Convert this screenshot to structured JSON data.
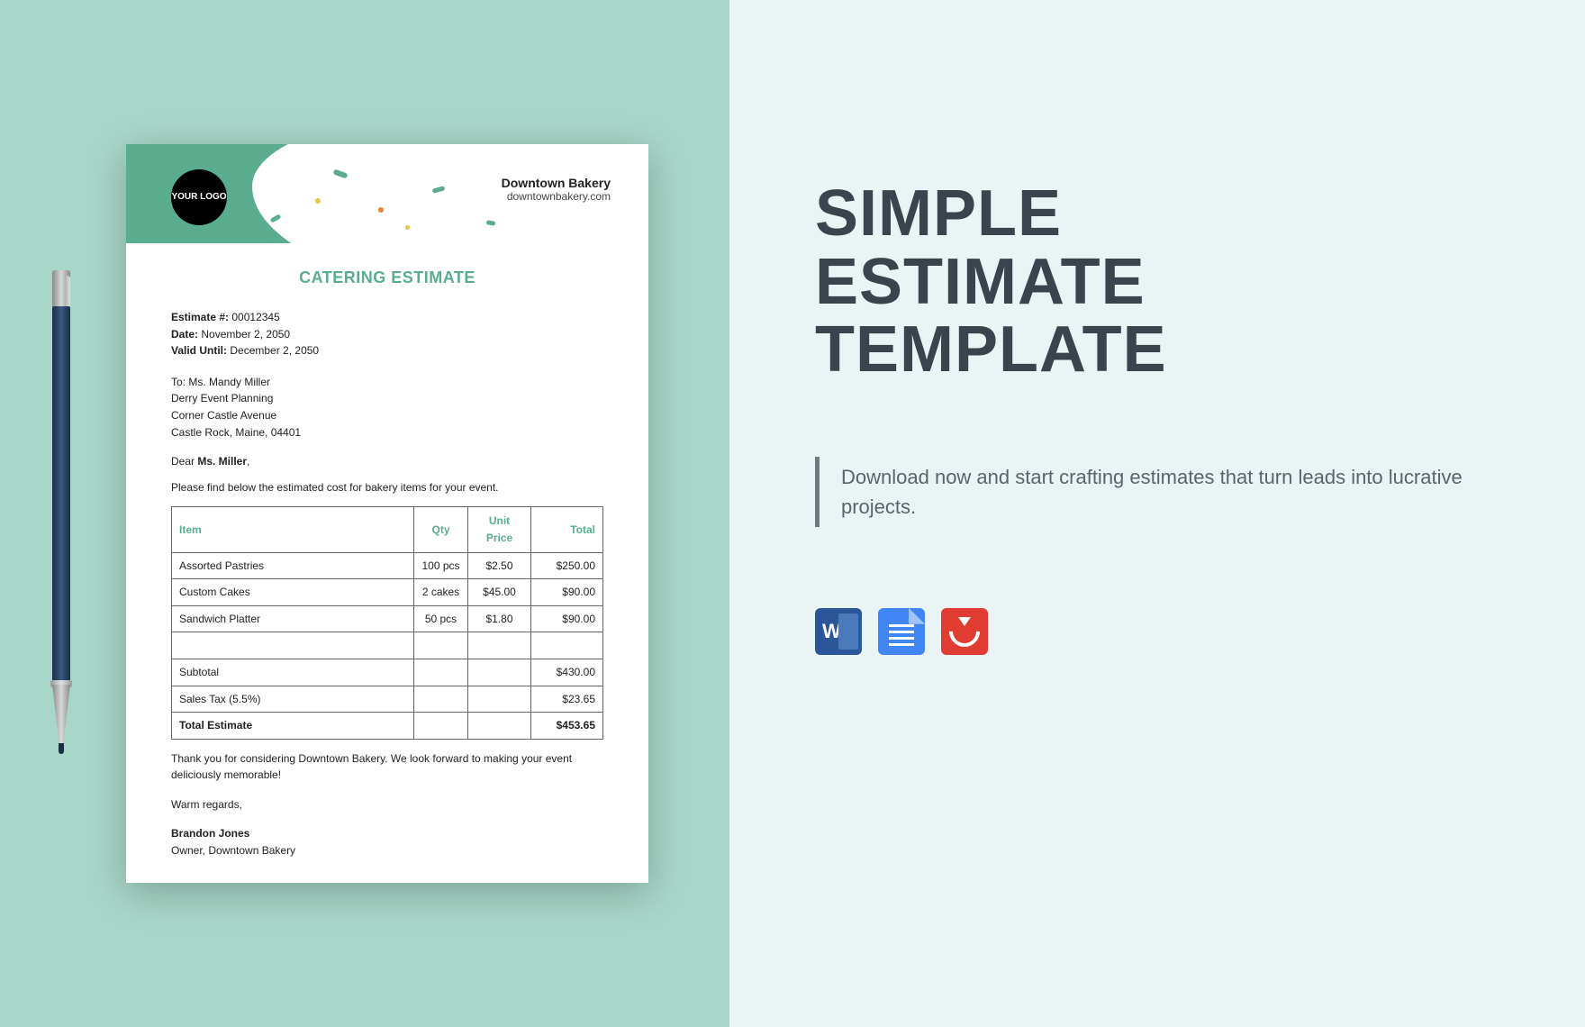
{
  "document": {
    "logo_text": "YOUR LOGO",
    "company_name": "Downtown Bakery",
    "company_url": "downtownbakery.com",
    "title": "CATERING ESTIMATE",
    "meta": {
      "estimate_label": "Estimate #:",
      "estimate_value": "00012345",
      "date_label": "Date:",
      "date_value": "November 2, 2050",
      "valid_label": "Valid Until:",
      "valid_value": "December 2, 2050"
    },
    "to": {
      "line1": "To: Ms. Mandy Miller",
      "line2": "Derry Event Planning",
      "line3": "Corner Castle Avenue",
      "line4": "Castle Rock, Maine, 04401"
    },
    "salutation_prefix": "Dear ",
    "salutation_name": "Ms. Miller",
    "salutation_suffix": ",",
    "intro": "Please find below the estimated cost for bakery items for your event.",
    "table": {
      "headers": {
        "item": "Item",
        "qty": "Qty",
        "unit": "Unit Price",
        "total": "Total"
      },
      "rows": [
        {
          "item": "Assorted Pastries",
          "qty": "100 pcs",
          "unit": "$2.50",
          "total": "$250.00"
        },
        {
          "item": "Custom Cakes",
          "qty": "2 cakes",
          "unit": "$45.00",
          "total": "$90.00"
        },
        {
          "item": "Sandwich Platter",
          "qty": "50 pcs",
          "unit": "$1.80",
          "total": "$90.00"
        }
      ],
      "subtotal_label": "Subtotal",
      "subtotal_value": "$430.00",
      "tax_label": "Sales Tax (5.5%)",
      "tax_value": "$23.65",
      "total_label": "Total Estimate",
      "total_value": "$453.65"
    },
    "thanks": "Thank you for considering Downtown Bakery. We look forward to making your event deliciously memorable!",
    "regards": "Warm regards,",
    "signer_name": "Brandon Jones",
    "signer_title": "Owner, Downtown Bakery"
  },
  "page": {
    "title_line1": "SIMPLE",
    "title_line2": "ESTIMATE",
    "title_line3": "TEMPLATE",
    "description": "Download now and start crafting estimates that turn leads into lucrative projects.",
    "formats": {
      "word": "Word",
      "gdocs": "Google Docs",
      "pdf": "PDF"
    }
  }
}
